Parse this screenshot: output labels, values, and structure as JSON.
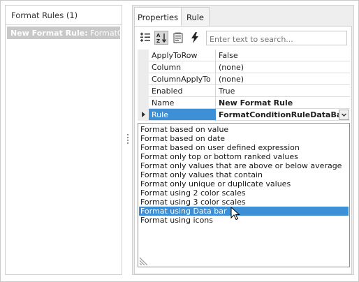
{
  "left_pane": {
    "title": "Format Rules (1)",
    "item_bold": "New Format Rule:",
    "item_rest": " FormatCon"
  },
  "tabs": [
    {
      "label": "Properties",
      "active": true
    },
    {
      "label": "Rule",
      "active": false
    }
  ],
  "toolbar": {
    "categorized_icon": "categorized-icon",
    "alphabetical_icon": "sort-alphabetical-icon",
    "property_pages_icon": "property-pages-icon",
    "events_icon": "lightning-icon",
    "search_placeholder": "Enter text to search..."
  },
  "properties": [
    {
      "name": "ApplyToRow",
      "value": "False"
    },
    {
      "name": "Column",
      "value": "(none)"
    },
    {
      "name": "ColumnApplyTo",
      "value": "(none)"
    },
    {
      "name": "Enabled",
      "value": "True"
    },
    {
      "name": "Name",
      "value": "New Format Rule"
    },
    {
      "name": "Rule",
      "value": "FormatConditionRuleDataBar"
    }
  ],
  "dropdown_options": [
    "Format based on value",
    "Format based on date",
    "Format based on user defined expression",
    "Format only top or bottom ranked values",
    "Format only values that are above or below average",
    "Format only values that contain",
    "Format only unique or duplicate values",
    "Format using 2 color scales",
    "Format using 3 color scales",
    "Format using Data bar",
    "Format using icons"
  ],
  "dropdown_selected": "Format using Data bar",
  "colors": {
    "selection": "#3d8fd6",
    "left_item_bg": "#c8c8c8",
    "pane_bg": "#eeeeee"
  }
}
